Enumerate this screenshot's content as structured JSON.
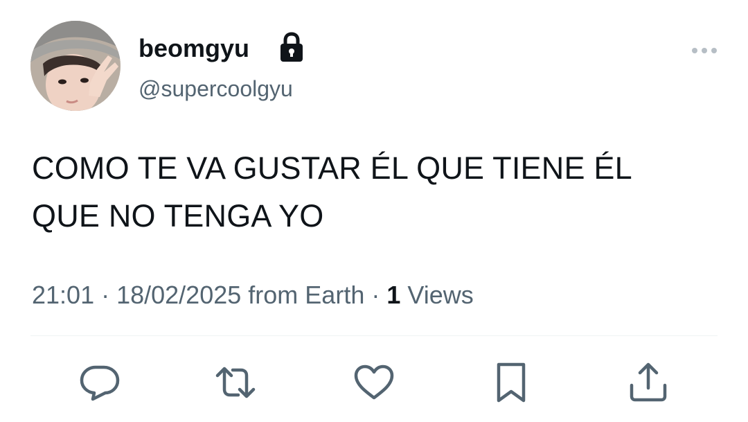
{
  "author": {
    "display_name": "beomgyu",
    "handle": "@supercoolgyu",
    "protected": true,
    "avatar_icon": "profile-photo"
  },
  "tweet": {
    "text_lines": [
      "COMO TE VA GUSTAR ÉL QUE TIENE ÉL",
      "QUE NO TENGA YO"
    ]
  },
  "meta": {
    "time": "21:01",
    "separator": "·",
    "date": "18/02/2025",
    "source": "from Earth",
    "views_count": "1",
    "views_label": "Views"
  },
  "actions": [
    {
      "name": "reply",
      "icon": "reply-icon"
    },
    {
      "name": "retweet",
      "icon": "retweet-icon"
    },
    {
      "name": "like",
      "icon": "heart-icon"
    },
    {
      "name": "bookmark",
      "icon": "bookmark-icon"
    },
    {
      "name": "share",
      "icon": "share-icon"
    }
  ],
  "colors": {
    "text_primary": "#0f1419",
    "text_secondary": "#536471",
    "divider": "#eff3f4",
    "icon": "#536471"
  }
}
